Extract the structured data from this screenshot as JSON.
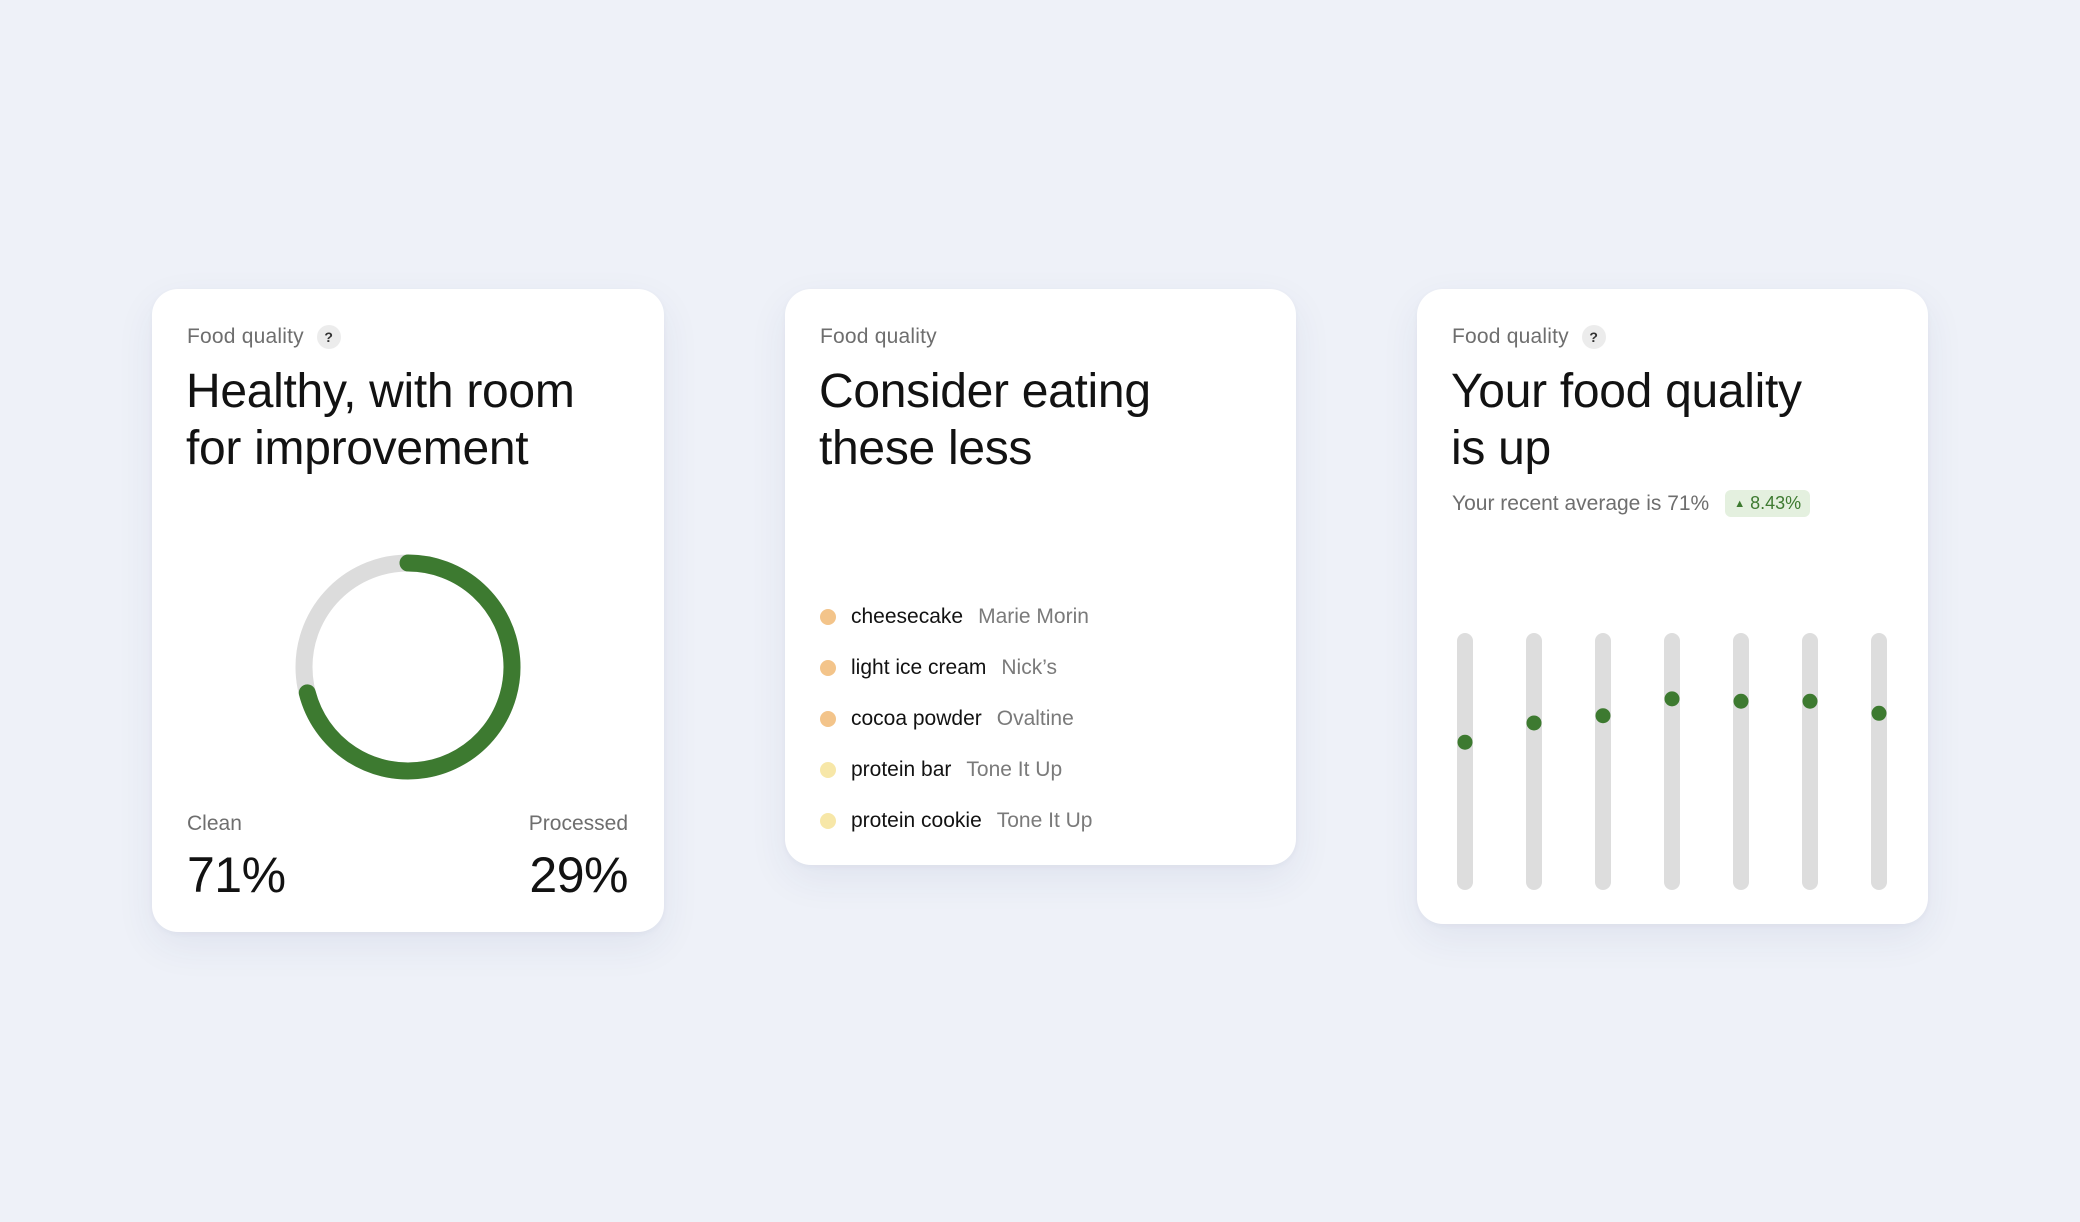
{
  "cards": [
    {
      "eyebrow": "Food quality",
      "help": "?",
      "title_line1": "Healthy, with room",
      "title_line2": "for improvement",
      "clean": {
        "label": "Clean",
        "value": "71%",
        "fraction": 0.71
      },
      "processed": {
        "label": "Processed",
        "value": "29%"
      },
      "colors": {
        "clean": "#3d7a30",
        "track": "#dcdcdc"
      }
    },
    {
      "eyebrow": "Food quality",
      "title_line1": "Consider eating",
      "title_line2": "these less",
      "items": [
        {
          "name": "cheesecake",
          "brand": "Marie Morin",
          "color": "#f3c48a"
        },
        {
          "name": "light ice cream",
          "brand": "Nick’s",
          "color": "#f3c48a"
        },
        {
          "name": "cocoa powder",
          "brand": "Ovaltine",
          "color": "#f3c48a"
        },
        {
          "name": "protein bar",
          "brand": "Tone It Up",
          "color": "#f7e7a8"
        },
        {
          "name": "protein cookie",
          "brand": "Tone It Up",
          "color": "#f7e7a8"
        }
      ]
    },
    {
      "eyebrow": "Food quality",
      "help": "?",
      "title_line1": "Your food quality",
      "title_line2": "is up",
      "subline": "Your recent average is 71%",
      "badge": "8.43%",
      "badge_arrow": "▲",
      "colors": {
        "dot": "#3d7a30",
        "track": "#dddddd"
      }
    }
  ],
  "chart_data": {
    "type": "scatter",
    "title": "",
    "xlabel": "",
    "ylabel": "",
    "ylim": [
      0,
      100
    ],
    "x": [
      1,
      2,
      3,
      4,
      5,
      6,
      7
    ],
    "values": [
      58,
      66,
      69,
      76,
      75,
      75,
      70
    ]
  }
}
